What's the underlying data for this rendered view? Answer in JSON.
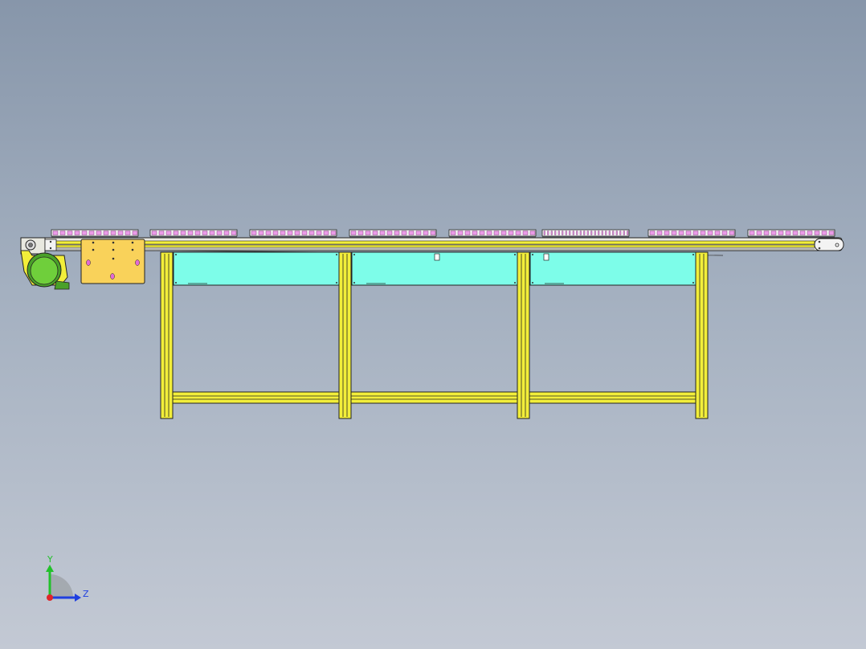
{
  "viewport": {
    "background_top": "#8796aa",
    "background_bottom": "#c3c9d4"
  },
  "model": {
    "description_icon": "conveyor-model",
    "frame_color": "#f2ee3a",
    "panel_color": "#7dfde9",
    "motor_color": "#6fcf3b",
    "plate_color": "#f9d25a",
    "chain_color": "#e99ae6"
  },
  "triad": {
    "y_label": "Y",
    "z_label": "Z",
    "y_color": "#22c12a",
    "z_color": "#1f3fe0",
    "x_color": "#e0242a"
  }
}
